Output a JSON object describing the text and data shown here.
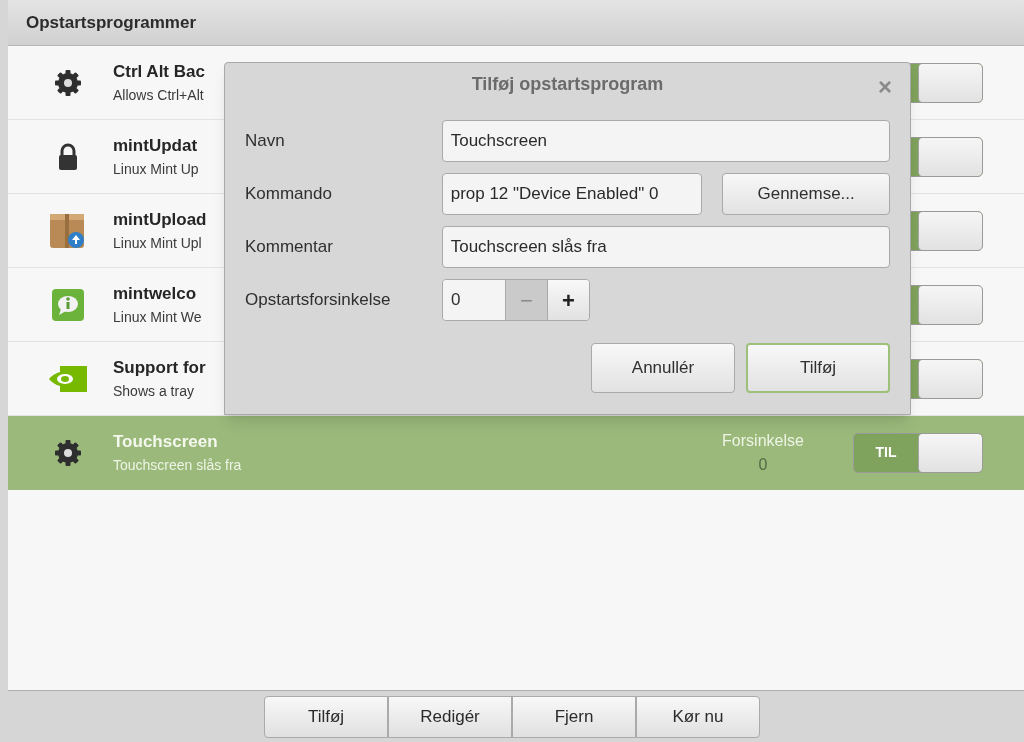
{
  "window": {
    "title": "Opstartsprogrammer"
  },
  "rows": [
    {
      "kind": "gear",
      "name": "Ctrl Alt Bac",
      "description": "Allows Ctrl+Alt",
      "on": true,
      "selected": false
    },
    {
      "kind": "lock",
      "name": "mintUpdat",
      "description": "Linux Mint Up",
      "on": true,
      "selected": false
    },
    {
      "kind": "package",
      "name": "mintUpload",
      "description": "Linux Mint Upl",
      "on": true,
      "selected": false
    },
    {
      "kind": "info",
      "name": "mintwelco",
      "description": "Linux Mint We",
      "on": true,
      "selected": false
    },
    {
      "kind": "eye",
      "name": "Support for",
      "description": "Shows a tray",
      "on": true,
      "selected": false
    },
    {
      "kind": "gear",
      "name": "Touchscreen",
      "description": "Touchscreen slås fra",
      "delay_label": "Forsinkelse",
      "delay": "0",
      "switch_label": "TIL",
      "on": true,
      "selected": true
    }
  ],
  "dialog": {
    "title": "Tilføj opstartsprogram",
    "close": "×",
    "fields": [
      {
        "kind": "text",
        "label": "Navn",
        "value": "Touchscreen"
      },
      {
        "kind": "browse",
        "label": "Kommando",
        "value": "prop 12 \"Device Enabled\" 0",
        "button": "Gennemse..."
      },
      {
        "kind": "text",
        "label": "Kommentar",
        "value": "Touchscreen slås fra"
      },
      {
        "kind": "spin",
        "label": "Opstartsforsinkelse",
        "value": "0",
        "minus": "−",
        "plus": "+",
        "minus_disabled": true
      }
    ],
    "buttons": [
      {
        "label": "Annullér",
        "default": false
      },
      {
        "label": "Tilføj",
        "default": true
      }
    ]
  },
  "toolbar": [
    "Tilføj",
    "Redigér",
    "Fjern",
    "Kør nu"
  ]
}
